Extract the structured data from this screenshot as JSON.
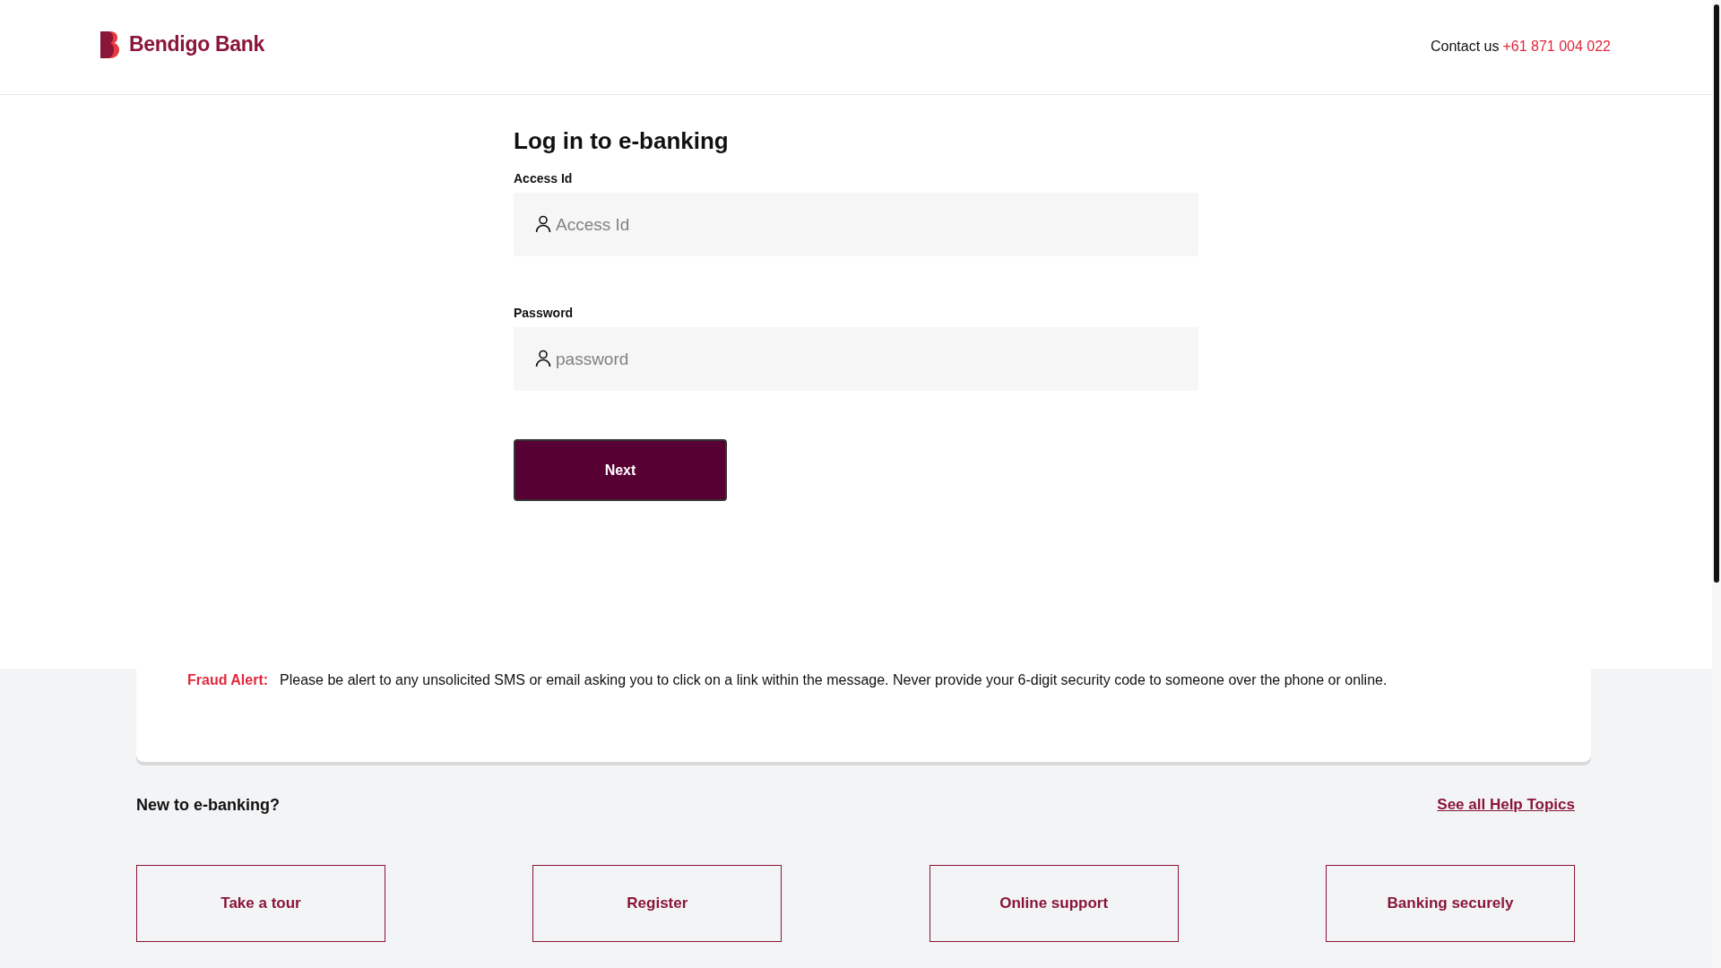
{
  "header": {
    "brand": "Bendigo Bank",
    "contact_label": "Contact us",
    "contact_phone": "+61 871 004 022"
  },
  "login": {
    "title": "Log in to e-banking",
    "fields": [
      {
        "label": "Access Id",
        "placeholder": "Access Id"
      },
      {
        "label": "Password",
        "placeholder": "password"
      }
    ],
    "button": "Next"
  },
  "fraud_alert": {
    "label": "Fraud Alert:",
    "message": "Please be alert to any unsolicited SMS or email asking you to click on a link within the message. Never provide your 6-digit security code to someone over the phone or online."
  },
  "help": {
    "title": "New to e-banking?",
    "link": "See all Help Topics",
    "tiles": [
      "Take a tour",
      "Register",
      "Online support",
      "Banking securely"
    ]
  }
}
